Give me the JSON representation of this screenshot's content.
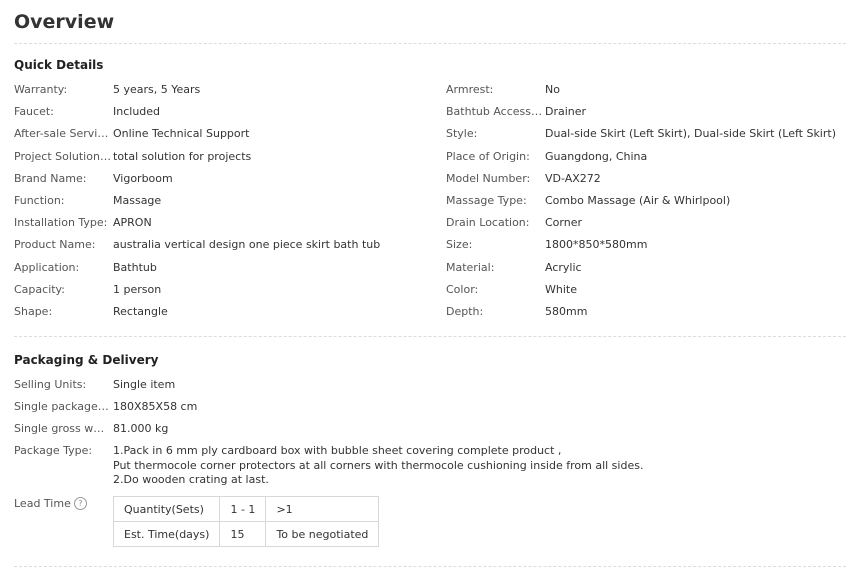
{
  "page_title": "Overview",
  "quick_details": {
    "heading": "Quick Details",
    "left": [
      {
        "label": "Warranty:",
        "value": "5 years, 5 Years"
      },
      {
        "label": "Faucet:",
        "value": "Included"
      },
      {
        "label": "After-sale Service:",
        "value": "Online Technical Support"
      },
      {
        "label": "Project Solution ...",
        "value": "total solution for projects"
      },
      {
        "label": "Brand Name:",
        "value": "Vigorboom"
      },
      {
        "label": "Function:",
        "value": "Massage"
      },
      {
        "label": "Installation Type:",
        "value": "APRON"
      },
      {
        "label": "Product Name:",
        "value": "australia vertical design one piece skirt bath tub"
      },
      {
        "label": "Application:",
        "value": "Bathtub"
      },
      {
        "label": "Capacity:",
        "value": "1 person"
      },
      {
        "label": "Shape:",
        "value": "Rectangle"
      }
    ],
    "right": [
      {
        "label": "Armrest:",
        "value": "No"
      },
      {
        "label": "Bathtub Accesso...",
        "value": "Drainer"
      },
      {
        "label": "Style:",
        "value": "Dual-side Skirt (Left Skirt), Dual-side Skirt (Left Skirt)"
      },
      {
        "label": "Place of Origin:",
        "value": "Guangdong, China"
      },
      {
        "label": "Model Number:",
        "value": "VD-AX272"
      },
      {
        "label": "Massage Type:",
        "value": "Combo Massage (Air & Whirlpool)"
      },
      {
        "label": "Drain Location:",
        "value": "Corner"
      },
      {
        "label": "Size:",
        "value": "1800*850*580mm"
      },
      {
        "label": "Material:",
        "value": "Acrylic"
      },
      {
        "label": "Color:",
        "value": "White"
      },
      {
        "label": "Depth:",
        "value": "580mm"
      }
    ]
  },
  "packaging": {
    "heading": "Packaging & Delivery",
    "rows": [
      {
        "label": "Selling Units:",
        "value": "Single item"
      },
      {
        "label": "Single package si...",
        "value": "180X85X58 cm"
      },
      {
        "label": "Single gross wei...",
        "value": "81.000 kg"
      }
    ],
    "package_type_label": "Package Type:",
    "package_type_lines": [
      "1.Pack in 6 mm ply cardboard box with bubble sheet covering complete product ,",
      "Put thermocole corner protectors at all corners with thermocole cushioning inside from all sides.",
      "2.Do wooden crating at last."
    ],
    "lead_time": {
      "label": "Lead Time",
      "help_icon": "?",
      "rows": [
        [
          "Quantity(Sets)",
          "1 - 1",
          ">1"
        ],
        [
          "Est. Time(days)",
          "15",
          "To be negotiated"
        ]
      ]
    }
  }
}
